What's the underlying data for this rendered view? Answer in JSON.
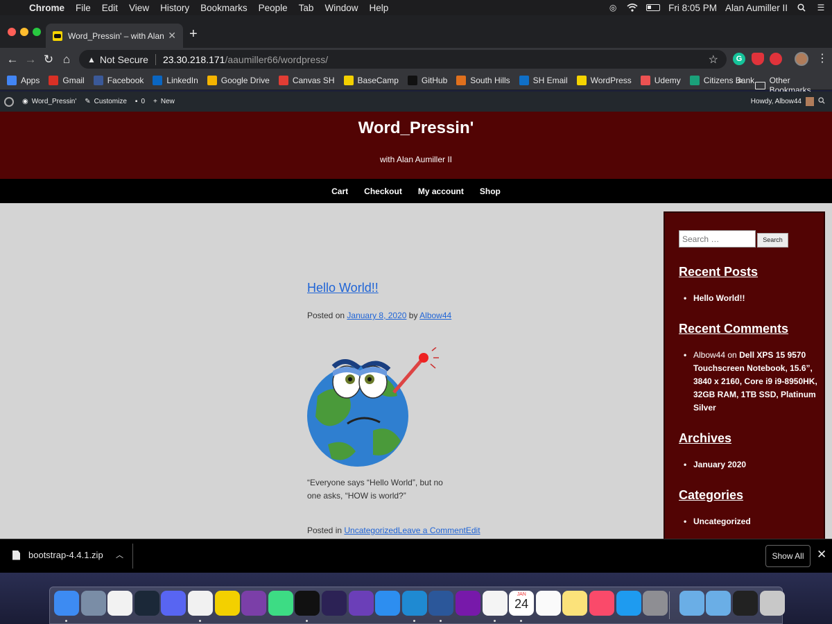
{
  "menubar": {
    "app": "Chrome",
    "items": [
      "File",
      "Edit",
      "View",
      "History",
      "Bookmarks",
      "People",
      "Tab",
      "Window",
      "Help"
    ],
    "clock": "Fri 8:05 PM",
    "user": "Alan Aumiller II"
  },
  "browser": {
    "tab_title": "Word_Pressin' – with Alan Aumiller",
    "security_label": "Not Secure",
    "url_host": "23.30.218.171",
    "url_path": "/aaumiller66/wordpress/",
    "bookmarks": [
      {
        "label": "Apps",
        "color": "#4285f4"
      },
      {
        "label": "Gmail",
        "color": "#d93025"
      },
      {
        "label": "Facebook",
        "color": "#3b5998"
      },
      {
        "label": "LinkedIn",
        "color": "#0a66c2"
      },
      {
        "label": "Google Drive",
        "color": "#f4b400"
      },
      {
        "label": "Canvas SH",
        "color": "#e13d34"
      },
      {
        "label": "BaseCamp",
        "color": "#f3d000"
      },
      {
        "label": "GitHub",
        "color": "#111111"
      },
      {
        "label": "South Hills",
        "color": "#e0701d"
      },
      {
        "label": "SH Email",
        "color": "#0f6fc6"
      },
      {
        "label": "WordPress",
        "color": "#f5d400"
      },
      {
        "label": "Udemy",
        "color": "#ec5252"
      },
      {
        "label": "Citizens Bank",
        "color": "#1aa17a"
      }
    ],
    "bookmarks_more": "»",
    "other_bookmarks": "Other Bookmarks"
  },
  "wp_admin": {
    "site_name": "Word_Pressin'",
    "customize": "Customize",
    "comments_count": "0",
    "new_label": "New",
    "howdy": "Howdy, Albow44"
  },
  "site": {
    "title": "Word_Pressin'",
    "tagline": "with Alan Aumiller II",
    "nav": [
      "Cart",
      "Checkout",
      "My account",
      "Shop"
    ]
  },
  "post": {
    "title": "Hello World!!",
    "posted_on": "Posted on",
    "date": "January 8, 2020",
    "by": "by",
    "author": "Albow44",
    "quote": "“Everyone says “Hello World”, but no one asks, “HOW is world?”",
    "posted_in": "Posted in",
    "category": "Uncategorized",
    "leave_comment": "Leave a Comment",
    "edit": "Edit"
  },
  "sidebar": {
    "search_placeholder": "Search …",
    "search_button": "Search",
    "recent_posts_title": "Recent Posts",
    "recent_posts": [
      "Hello World!!"
    ],
    "recent_comments_title": "Recent Comments",
    "comment_author": "Albow44",
    "comment_on": "on",
    "comment_post": "Dell XPS 15 9570 Touchscreen Notebook, 15.6”, 3840 x 2160, Core i9 i9-8950HK, 32GB RAM, 1TB SSD, Platinum Silver",
    "archives_title": "Archives",
    "archives": [
      "January 2020"
    ],
    "categories_title": "Categories",
    "categories": [
      "Uncategorized"
    ]
  },
  "download": {
    "filename": "bootstrap-4.4.1.zip",
    "show_all": "Show All"
  },
  "dock": {
    "calendar_month": "JAN",
    "calendar_day": "24",
    "apps": [
      {
        "name": "finder",
        "color": "#3d8bf2"
      },
      {
        "name": "preview",
        "color": "#7a8da6"
      },
      {
        "name": "news",
        "color": "#f2f2f2"
      },
      {
        "name": "steam",
        "color": "#1b2838"
      },
      {
        "name": "discord",
        "color": "#5865f2"
      },
      {
        "name": "chrome",
        "color": "#f1f1f1"
      },
      {
        "name": "basecamp",
        "color": "#f3d000"
      },
      {
        "name": "github-desktop",
        "color": "#7b3fa8"
      },
      {
        "name": "android-studio",
        "color": "#3ddc84"
      },
      {
        "name": "terminal",
        "color": "#111111"
      },
      {
        "name": "eclipse",
        "color": "#2c2255"
      },
      {
        "name": "visual-studio",
        "color": "#6b3fb8"
      },
      {
        "name": "xcode",
        "color": "#2d8ef0"
      },
      {
        "name": "vscode",
        "color": "#1f8ad2"
      },
      {
        "name": "word",
        "color": "#2b579a"
      },
      {
        "name": "onenote",
        "color": "#7719aa"
      },
      {
        "name": "acrobat",
        "color": "#f4f4f4"
      },
      {
        "name": "calendar",
        "color": "#ffffff"
      },
      {
        "name": "reminders",
        "color": "#fafafa"
      },
      {
        "name": "notes",
        "color": "#fbe27a"
      },
      {
        "name": "music",
        "color": "#fa4a6a"
      },
      {
        "name": "app-store",
        "color": "#1e9bf0"
      },
      {
        "name": "system-preferences",
        "color": "#8e8e93"
      },
      {
        "name": "downloads-folder",
        "color": "#6aaee6"
      },
      {
        "name": "applications-folder",
        "color": "#6aaee6"
      },
      {
        "name": "screen-recorder",
        "color": "#222222"
      },
      {
        "name": "trash",
        "color": "#c8c8c8"
      }
    ]
  },
  "colors": {
    "header_bg": "#520404",
    "nav_bg": "#000000",
    "content_bg": "#d4d4d4",
    "link": "#1f64d6"
  }
}
